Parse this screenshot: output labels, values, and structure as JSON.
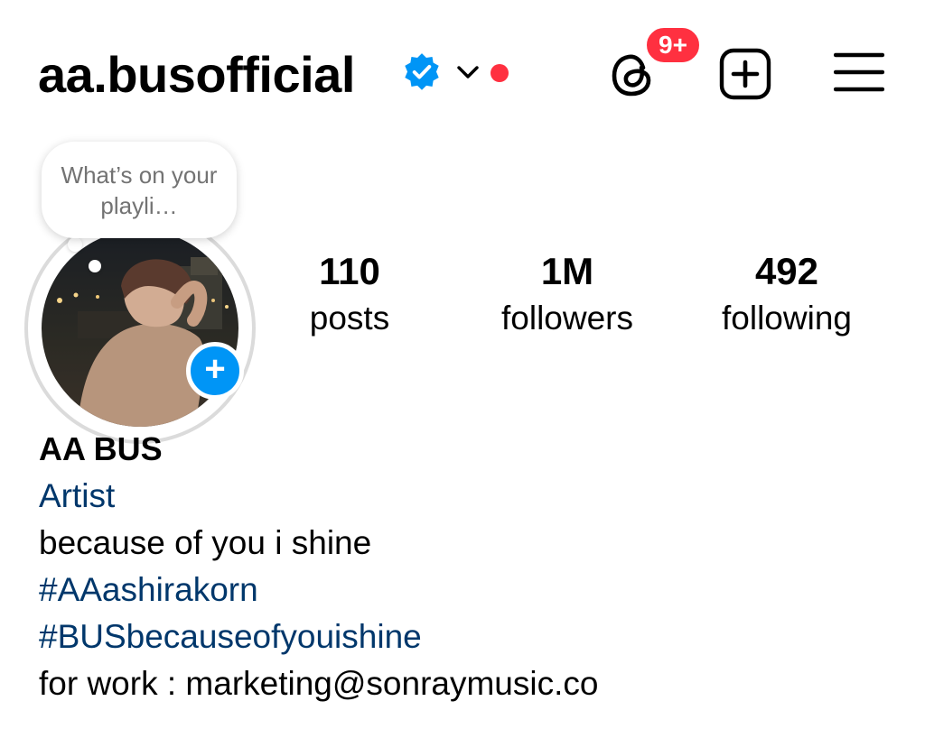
{
  "header": {
    "username": "aa.busofficial",
    "verified_icon": "verified-badge-icon",
    "dropdown_icon": "chevron-down-icon",
    "threads_icon": "threads-icon",
    "notification_badge": "9+",
    "create_icon": "plus-square-icon",
    "menu_icon": "hamburger-menu-icon"
  },
  "profile": {
    "note_bubble": "What’s on your playli…",
    "add_story_icon": "plus-circle-icon",
    "stats": [
      {
        "value": "110",
        "label": "posts"
      },
      {
        "value": "1M",
        "label": "followers"
      },
      {
        "value": "492",
        "label": "following"
      }
    ]
  },
  "bio": {
    "display_name": "AA BUS",
    "category": "Artist",
    "line1": "because of you i shine",
    "hashtag1": "#AAashirakorn",
    "hashtag2": "#BUSbecauseofyouishine",
    "contact": "for work : marketing@sonraymusic.co"
  },
  "colors": {
    "verified_blue": "#0095f6",
    "notification_red": "#ff3040",
    "link_blue": "#00376b",
    "muted_gray": "#737373"
  }
}
